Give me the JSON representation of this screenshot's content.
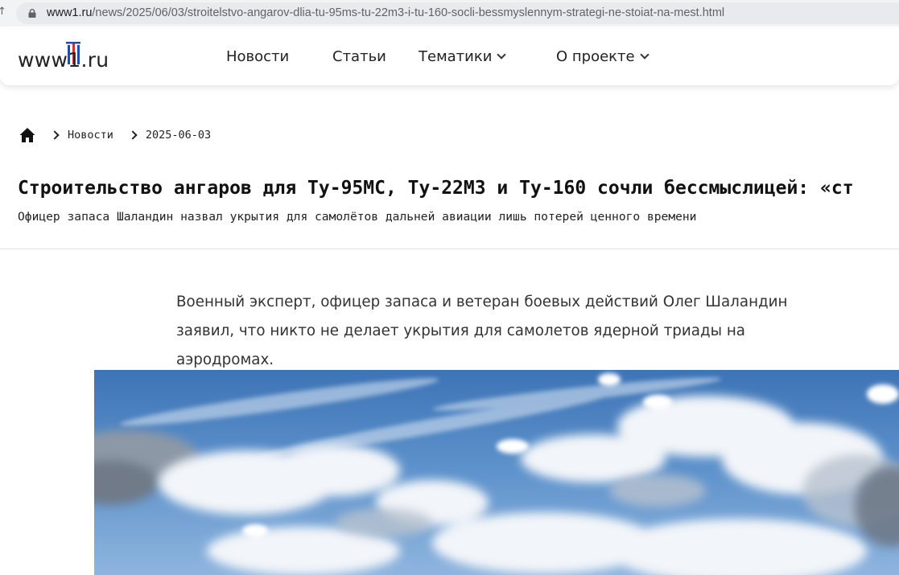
{
  "browser": {
    "url_host": "www1.ru",
    "url_path": "/news/2025/06/03/stroitelstvo-angarov-dlia-tu-95ms-tu-22m3-i-tu-160-socli-bessmyslennym-strategi-ne-stoiat-na-mest.html"
  },
  "header": {
    "logo_text": "www1.ru",
    "nav": {
      "news": "Новости",
      "articles": "Статьи",
      "topics": "Тематики",
      "about": "О проекте"
    }
  },
  "breadcrumb": {
    "section": "Новости",
    "date": "2025-06-03"
  },
  "article": {
    "title": "Строительство ангаров для Ту-95МС, Ту-22М3 и Ту-160 сочли бессмыслицей: «ст",
    "subtitle": "Офицер запаса Шаландин назвал укрытия для самолётов дальней авиации лишь потерей ценного времени",
    "lead": "Военный эксперт, офицер запаса и ветеран боевых действий Олег Шаландин заявил, что никто не делает укрытия для самолетов ядерной триады на аэродромах."
  },
  "colors": {
    "accent_red": "#d32f2f",
    "accent_blue": "#1f4ea3",
    "sky": "#5b8fc8"
  }
}
